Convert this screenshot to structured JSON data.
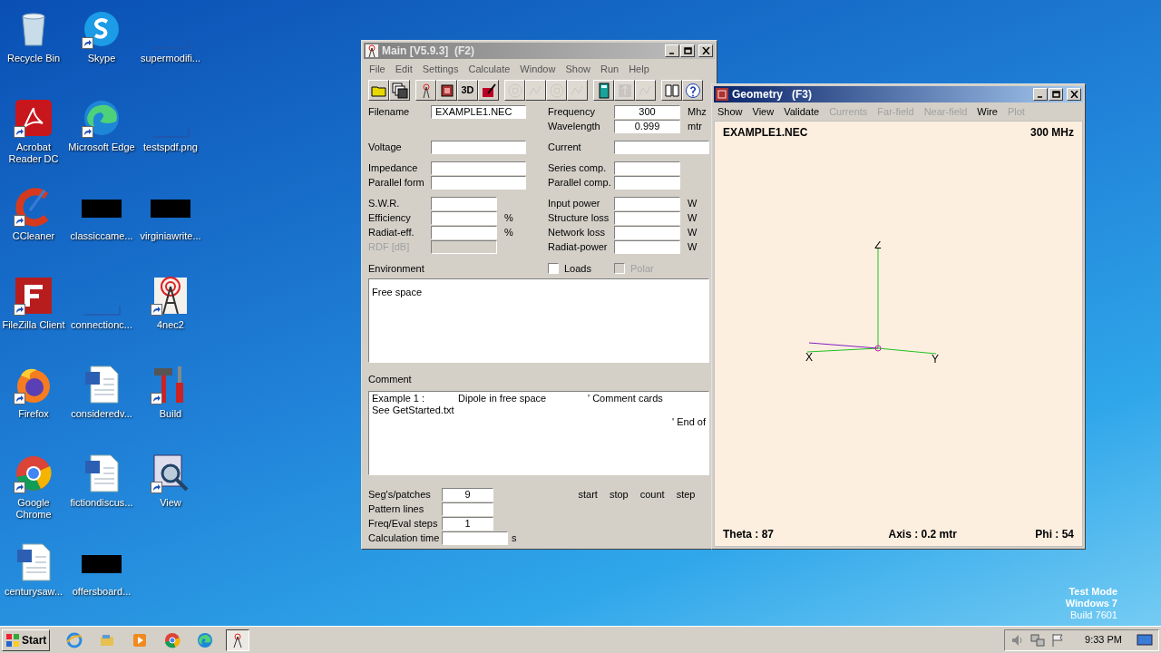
{
  "desktop": {
    "icons": [
      {
        "label": "Recycle Bin",
        "kind": "recycle",
        "shortcut": false
      },
      {
        "label": "Skype",
        "kind": "skype",
        "shortcut": true
      },
      {
        "label": "supermodifi...",
        "kind": "blank",
        "shortcut": false
      },
      {
        "label": "Acrobat Reader DC",
        "kind": "acrobat",
        "shortcut": true
      },
      {
        "label": "Microsoft Edge",
        "kind": "edge",
        "shortcut": true
      },
      {
        "label": "testspdf.png",
        "kind": "blank",
        "shortcut": false
      },
      {
        "label": "CCleaner",
        "kind": "ccleaner",
        "shortcut": true
      },
      {
        "label": "classiccame...",
        "kind": "redacted",
        "shortcut": false
      },
      {
        "label": "virginiawrite...",
        "kind": "redacted",
        "shortcut": false
      },
      {
        "label": "FileZilla Client",
        "kind": "filezilla",
        "shortcut": true
      },
      {
        "label": "connectionc...",
        "kind": "blank",
        "shortcut": false
      },
      {
        "label": "4nec2",
        "kind": "antenna",
        "shortcut": true
      },
      {
        "label": "Firefox",
        "kind": "firefox",
        "shortcut": true
      },
      {
        "label": "consideredv...",
        "kind": "word",
        "shortcut": false
      },
      {
        "label": "Build",
        "kind": "tools",
        "shortcut": true
      },
      {
        "label": "Google Chrome",
        "kind": "chrome",
        "shortcut": true
      },
      {
        "label": "fictiondiscus...",
        "kind": "word",
        "shortcut": false
      },
      {
        "label": "View",
        "kind": "view",
        "shortcut": true
      },
      {
        "label": "centurysaw...",
        "kind": "word",
        "shortcut": false
      },
      {
        "label": "offersboard...",
        "kind": "redacted",
        "shortcut": false
      }
    ],
    "os_notice": [
      "Test Mode",
      "Windows 7",
      "Build 7601"
    ]
  },
  "main": {
    "title": "Main [V5.9.3]  (F2)",
    "menu": [
      "File",
      "Edit",
      "Settings",
      "Calculate",
      "Window",
      "Show",
      "Run",
      "Help"
    ],
    "toolbar": [
      [
        {
          "kind": "folder",
          "disabled": false
        },
        {
          "kind": "save",
          "disabled": false
        }
      ],
      [
        {
          "kind": "antenna",
          "disabled": false
        },
        {
          "kind": "cube",
          "disabled": false
        },
        {
          "kind": "text",
          "label": "3D",
          "disabled": false
        },
        {
          "kind": "edit",
          "disabled": false
        }
      ],
      [
        {
          "kind": "rings",
          "disabled": true
        },
        {
          "kind": "pattern",
          "disabled": true
        },
        {
          "kind": "rings",
          "disabled": true
        },
        {
          "kind": "pattern",
          "disabled": true
        }
      ],
      [
        {
          "kind": "calculator",
          "disabled": false
        },
        {
          "kind": "arrows",
          "disabled": true
        },
        {
          "kind": "pattern",
          "disabled": true
        }
      ],
      [
        {
          "kind": "book",
          "disabled": false
        },
        {
          "kind": "help",
          "disabled": false
        }
      ]
    ],
    "blocks": [
      [
        {
          "left": {
            "label": "Filename",
            "value": "EXAMPLE1.NEC",
            "kind": "name"
          },
          "right": {
            "label": "Frequency",
            "value": "300",
            "unit": "Mhz",
            "kind": "number"
          }
        },
        {
          "right": {
            "label": "Wavelength",
            "value": "0.999",
            "unit": "mtr",
            "kind": "number"
          }
        }
      ],
      [
        {
          "left": {
            "label": "Voltage",
            "kind": "wide"
          },
          "right": {
            "label": "Current",
            "kind": "long"
          }
        }
      ],
      [
        {
          "left": {
            "label": "Impedance",
            "kind": "wide"
          },
          "right": {
            "label": "Series comp.",
            "kind": "number"
          }
        },
        {
          "left": {
            "label": "Parallel form",
            "kind": "wide"
          },
          "right": {
            "label": "Parallel comp.",
            "kind": "number"
          }
        }
      ],
      [
        {
          "left": {
            "label": "S.W.R.",
            "kind": "number"
          },
          "right": {
            "label": "Input power",
            "unit": "W",
            "kind": "number"
          }
        },
        {
          "left": {
            "label": "Efficiency",
            "unit": "%",
            "kind": "number"
          },
          "right": {
            "label": "Structure loss",
            "unit": "W",
            "kind": "number"
          }
        },
        {
          "left": {
            "label": "Radiat-eff.",
            "unit": "%",
            "kind": "number"
          },
          "right": {
            "label": "Network loss",
            "unit": "W",
            "kind": "number"
          }
        },
        {
          "left": {
            "label": "RDF [dB]",
            "kind": "number",
            "disabled": true
          },
          "right": {
            "label": "Radiat-power",
            "unit": "W",
            "kind": "number"
          }
        }
      ]
    ],
    "environment": {
      "label": "Environment",
      "checkboxes": [
        {
          "label": "Loads",
          "checked": false,
          "disabled": false
        },
        {
          "label": "Polar",
          "checked": false,
          "disabled": true
        }
      ],
      "text": "Free space"
    },
    "comment": {
      "label": "Comment",
      "lines": [
        [
          {
            "text": "Example 1 :",
            "kind": "left"
          },
          {
            "text": "Dipole in free space",
            "kind": "left"
          },
          {
            "text": "' Comment cards",
            "kind": "left"
          }
        ],
        [
          {
            "text": "See GetStarted.txt",
            "kind": "left"
          }
        ],
        [
          {
            "text": "' End of",
            "kind": "right"
          }
        ]
      ]
    },
    "sweep_headers": [
      "start",
      "stop",
      "count",
      "step"
    ],
    "bottom_fields": [
      {
        "label": "Seg's/patches",
        "value": "9"
      },
      {
        "label": "Pattern lines"
      },
      {
        "label": "Freq/Eval steps",
        "value": "1"
      },
      {
        "label": "Calculation time",
        "unit": "s",
        "kind": "time"
      }
    ]
  },
  "geometry": {
    "title": "Geometry   (F3)",
    "menu": [
      {
        "label": "Show",
        "disabled": false
      },
      {
        "label": "View",
        "disabled": false
      },
      {
        "label": "Validate",
        "disabled": false
      },
      {
        "label": "Currents",
        "disabled": true
      },
      {
        "label": "Far-field",
        "disabled": true
      },
      {
        "label": "Near-field",
        "disabled": true
      },
      {
        "label": "Wire",
        "disabled": false
      },
      {
        "label": "Plot",
        "disabled": true
      }
    ],
    "filename": "EXAMPLE1.NEC",
    "frequency": "300 MHz",
    "axis_labels": {
      "z": "Z",
      "x": "X",
      "y": "Y"
    },
    "theta": "Theta : 87",
    "axis": "Axis : 0.2 mtr",
    "phi": "Phi : 54"
  },
  "taskbar": {
    "start": "Start",
    "apps": [
      {
        "kind": "ie",
        "active": false
      },
      {
        "kind": "explorer",
        "active": false
      },
      {
        "kind": "media",
        "active": false
      },
      {
        "kind": "chrome",
        "active": false
      },
      {
        "kind": "edge",
        "active": false
      },
      {
        "kind": "antenna",
        "active": true
      }
    ],
    "tray": [
      {
        "kind": "volume"
      },
      {
        "kind": "network"
      },
      {
        "kind": "flag"
      }
    ],
    "time": "9:33 PM"
  }
}
